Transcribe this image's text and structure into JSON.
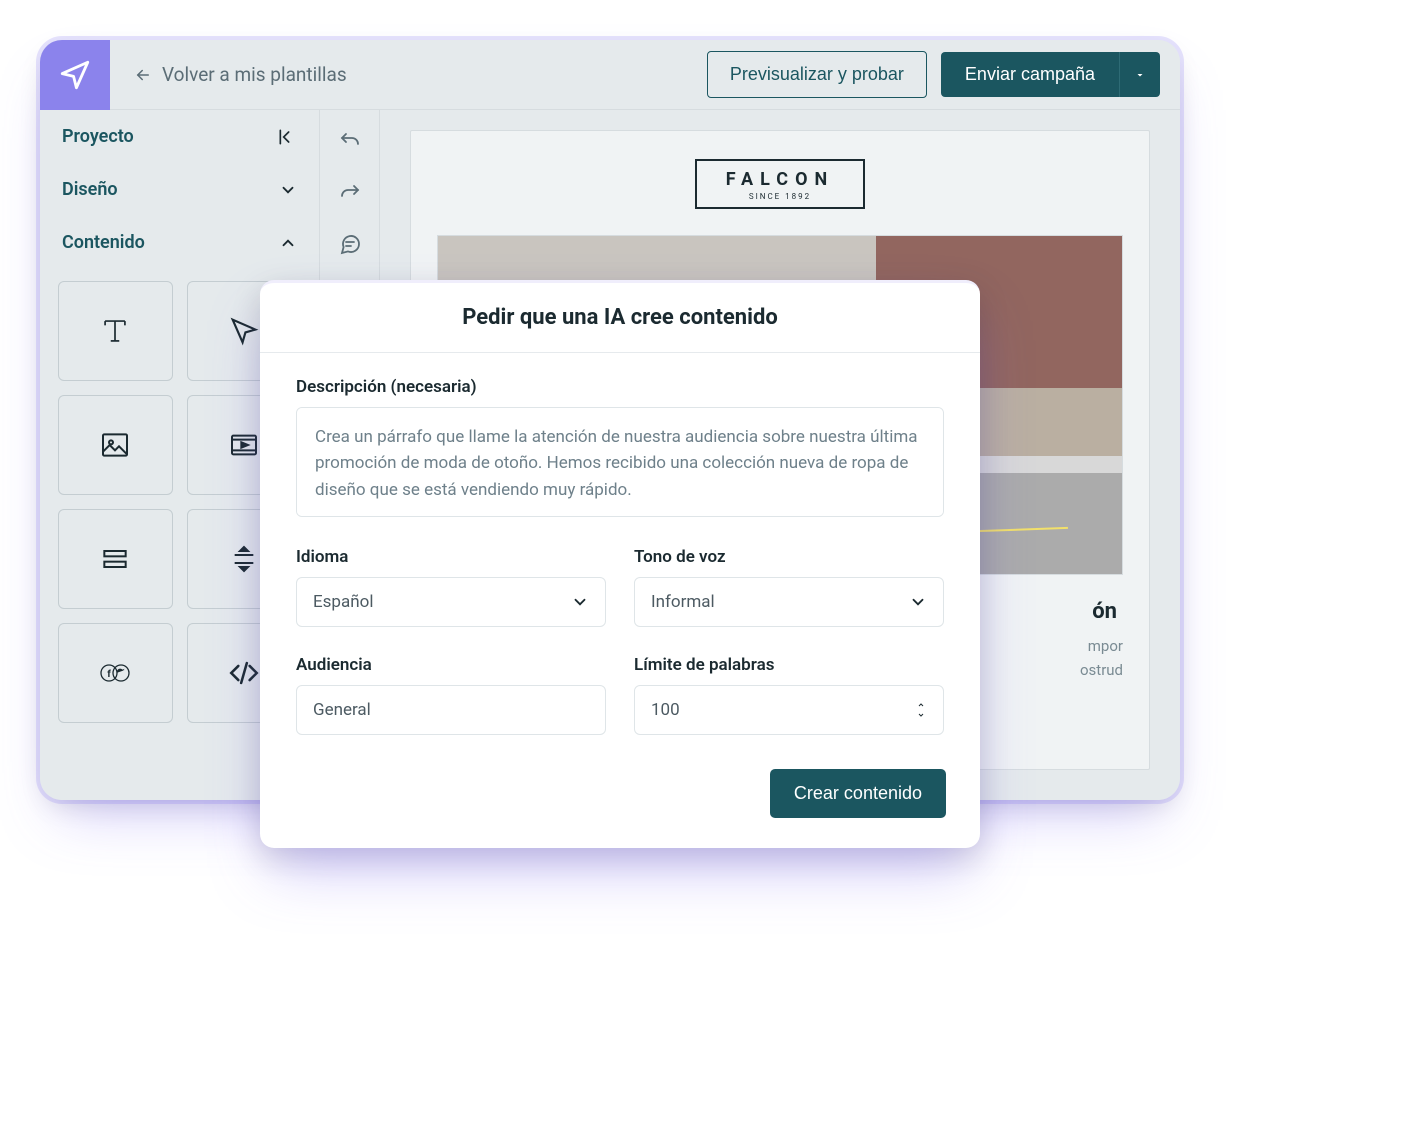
{
  "topbar": {
    "back_label": "Volver a mis plantillas",
    "preview_label": "Previsualizar y probar",
    "send_label": "Enviar campaña"
  },
  "sidebar": {
    "project_label": "Proyecto",
    "design_label": "Diseño",
    "content_label": "Contenido"
  },
  "canvas": {
    "brand_name": "FALCON",
    "brand_sub": "SINCE 1892",
    "article_title_suffix": "ón",
    "article_line_1_suffix": "mpor",
    "article_line_2_suffix": "ostrud"
  },
  "modal": {
    "title": "Pedir que una IA cree contenido",
    "description_label": "Descripción (necesaria)",
    "description_value": "Crea un párrafo que llame la atención de nuestra audiencia sobre nuestra última promoción de moda de otoño. Hemos recibido una colección nueva de ropa de diseño que se está vendiendo muy rápido.",
    "language_label": "Idioma",
    "language_value": "Español",
    "tone_label": "Tono de voz",
    "tone_value": "Informal",
    "audience_label": "Audiencia",
    "audience_value": "General",
    "wordlimit_label": "Límite de palabras",
    "wordlimit_value": "100",
    "create_label": "Crear contenido"
  }
}
